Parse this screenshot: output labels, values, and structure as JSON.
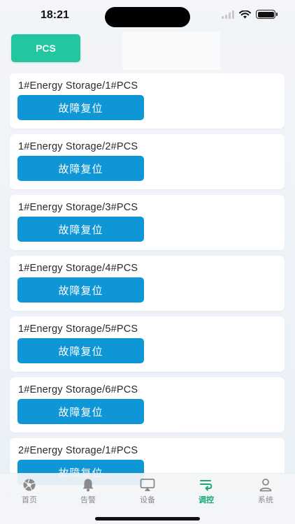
{
  "status_bar": {
    "time": "18:21"
  },
  "top_tab": {
    "label": "PCS"
  },
  "cards": [
    {
      "title": "1#Energy Storage/1#PCS",
      "button": "故障复位"
    },
    {
      "title": "1#Energy Storage/2#PCS",
      "button": "故障复位"
    },
    {
      "title": "1#Energy Storage/3#PCS",
      "button": "故障复位"
    },
    {
      "title": "1#Energy Storage/4#PCS",
      "button": "故障复位"
    },
    {
      "title": "1#Energy Storage/5#PCS",
      "button": "故障复位"
    },
    {
      "title": "1#Energy Storage/6#PCS",
      "button": "故障复位"
    },
    {
      "title": "2#Energy Storage/1#PCS",
      "button": "故障复位"
    }
  ],
  "tab_bar": {
    "items": [
      {
        "label": "首页",
        "icon": "aperture-icon"
      },
      {
        "label": "告警",
        "icon": "bell-icon"
      },
      {
        "label": "设备",
        "icon": "monitor-icon"
      },
      {
        "label": "调控",
        "icon": "control-icon",
        "active": true
      },
      {
        "label": "系统",
        "icon": "user-icon"
      }
    ]
  },
  "colors": {
    "accent_green": "#22c7a0",
    "button_blue": "#0e96d6",
    "active_tab": "#1aa874",
    "inactive_tab": "#8a8a8a"
  }
}
